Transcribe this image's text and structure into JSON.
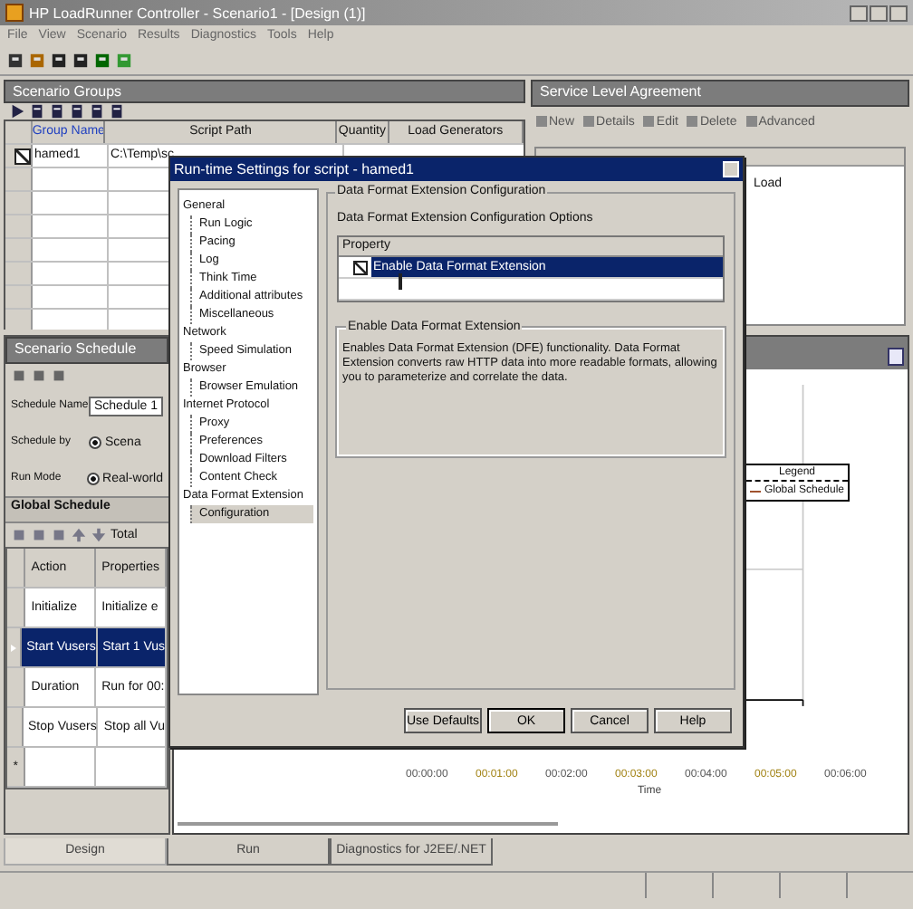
{
  "window": {
    "title": "HP LoadRunner Controller - Scenario1 - [Design (1)]"
  },
  "menu": [
    "File",
    "View",
    "Scenario",
    "Results",
    "Diagnostics",
    "Tools",
    "Help"
  ],
  "scenario_groups": {
    "title": "Scenario Groups",
    "columns": [
      "Group Name",
      "Script Path",
      "Quantity",
      "Load Generators"
    ],
    "rows": [
      {
        "checked": true,
        "cells": [
          "hamed1",
          "C:\\Temp\\sc"
        ]
      }
    ]
  },
  "sla": {
    "title": "Service Level Agreement",
    "buttons": [
      "New",
      "Details",
      "Edit",
      "Delete",
      "Advanced"
    ],
    "items": [
      "Load"
    ]
  },
  "schedule": {
    "title": "Scenario Schedule",
    "fields": [
      {
        "label": "Schedule Name",
        "kind": "input",
        "value": "Schedule 1"
      },
      {
        "label": "Schedule by",
        "kind": "radio",
        "value": "Scena",
        "selected": true
      },
      {
        "label": "Run Mode",
        "kind": "radio",
        "value": "Real-world",
        "selected": true
      }
    ],
    "global_title": "Global Schedule",
    "total": "Total",
    "columns": [
      "Action",
      "Properties"
    ],
    "rows": [
      {
        "cells": [
          "Initialize",
          "Initialize e"
        ],
        "selected": false
      },
      {
        "cells": [
          "Start Vusers",
          "Start 1 Vus"
        ],
        "selected": true
      },
      {
        "cells": [
          "Duration",
          "Run for 00:"
        ],
        "selected": false
      },
      {
        "cells": [
          "Stop Vusers",
          "Stop all Vu"
        ],
        "selected": false
      }
    ],
    "new_row": "*"
  },
  "schedule_graph": {
    "legend_title": "Legend",
    "legend_item": "Global Schedule",
    "x_ticks": [
      "00:00:00",
      "00:01:00",
      "00:02:00",
      "00:03:00",
      "00:04:00",
      "00:05:00",
      "00:06:00"
    ],
    "xlabel": "Time"
  },
  "tabs": [
    {
      "label": "Design",
      "selected": true
    },
    {
      "label": "Run",
      "selected": false
    },
    {
      "label": "Diagnostics for J2EE/.NET",
      "selected": false
    }
  ],
  "dialog": {
    "title": "Run-time Settings for script - hamed1",
    "tree": [
      {
        "label": "General",
        "selected": false,
        "children": [
          {
            "label": "Run Logic",
            "selected": false
          },
          {
            "label": "Pacing",
            "selected": false
          },
          {
            "label": "Log",
            "selected": false
          },
          {
            "label": "Think Time",
            "selected": false
          },
          {
            "label": "Additional attributes",
            "selected": false
          },
          {
            "label": "Miscellaneous",
            "selected": false
          }
        ]
      },
      {
        "label": "Network",
        "selected": false,
        "children": [
          {
            "label": "Speed Simulation",
            "selected": false
          }
        ]
      },
      {
        "label": "Browser",
        "selected": false,
        "children": [
          {
            "label": "Browser Emulation",
            "selected": false
          }
        ]
      },
      {
        "label": "Internet Protocol",
        "selected": false,
        "children": [
          {
            "label": "Proxy",
            "selected": false
          },
          {
            "label": "Preferences",
            "selected": false
          },
          {
            "label": "Download Filters",
            "selected": false
          },
          {
            "label": "Content Check",
            "selected": false
          }
        ]
      },
      {
        "label": "Data Format Extension",
        "selected": false,
        "children": [
          {
            "label": "Configuration",
            "selected": true
          }
        ]
      }
    ],
    "group_title": "Data Format Extension Configuration",
    "options_label": "Data Format Extension Configuration Options",
    "property_header": "Property",
    "properties": [
      {
        "label": "Enable Data Format Extension",
        "checked": true,
        "selected": true
      }
    ],
    "description_title": "Enable Data Format Extension",
    "description": "Enables Data Format Extension (DFE) functionality. Data Format Extension converts raw HTTP data into more readable formats, allowing you to parameterize and correlate the data.",
    "buttons": [
      "Use Defaults",
      "OK",
      "Cancel",
      "Help"
    ]
  }
}
